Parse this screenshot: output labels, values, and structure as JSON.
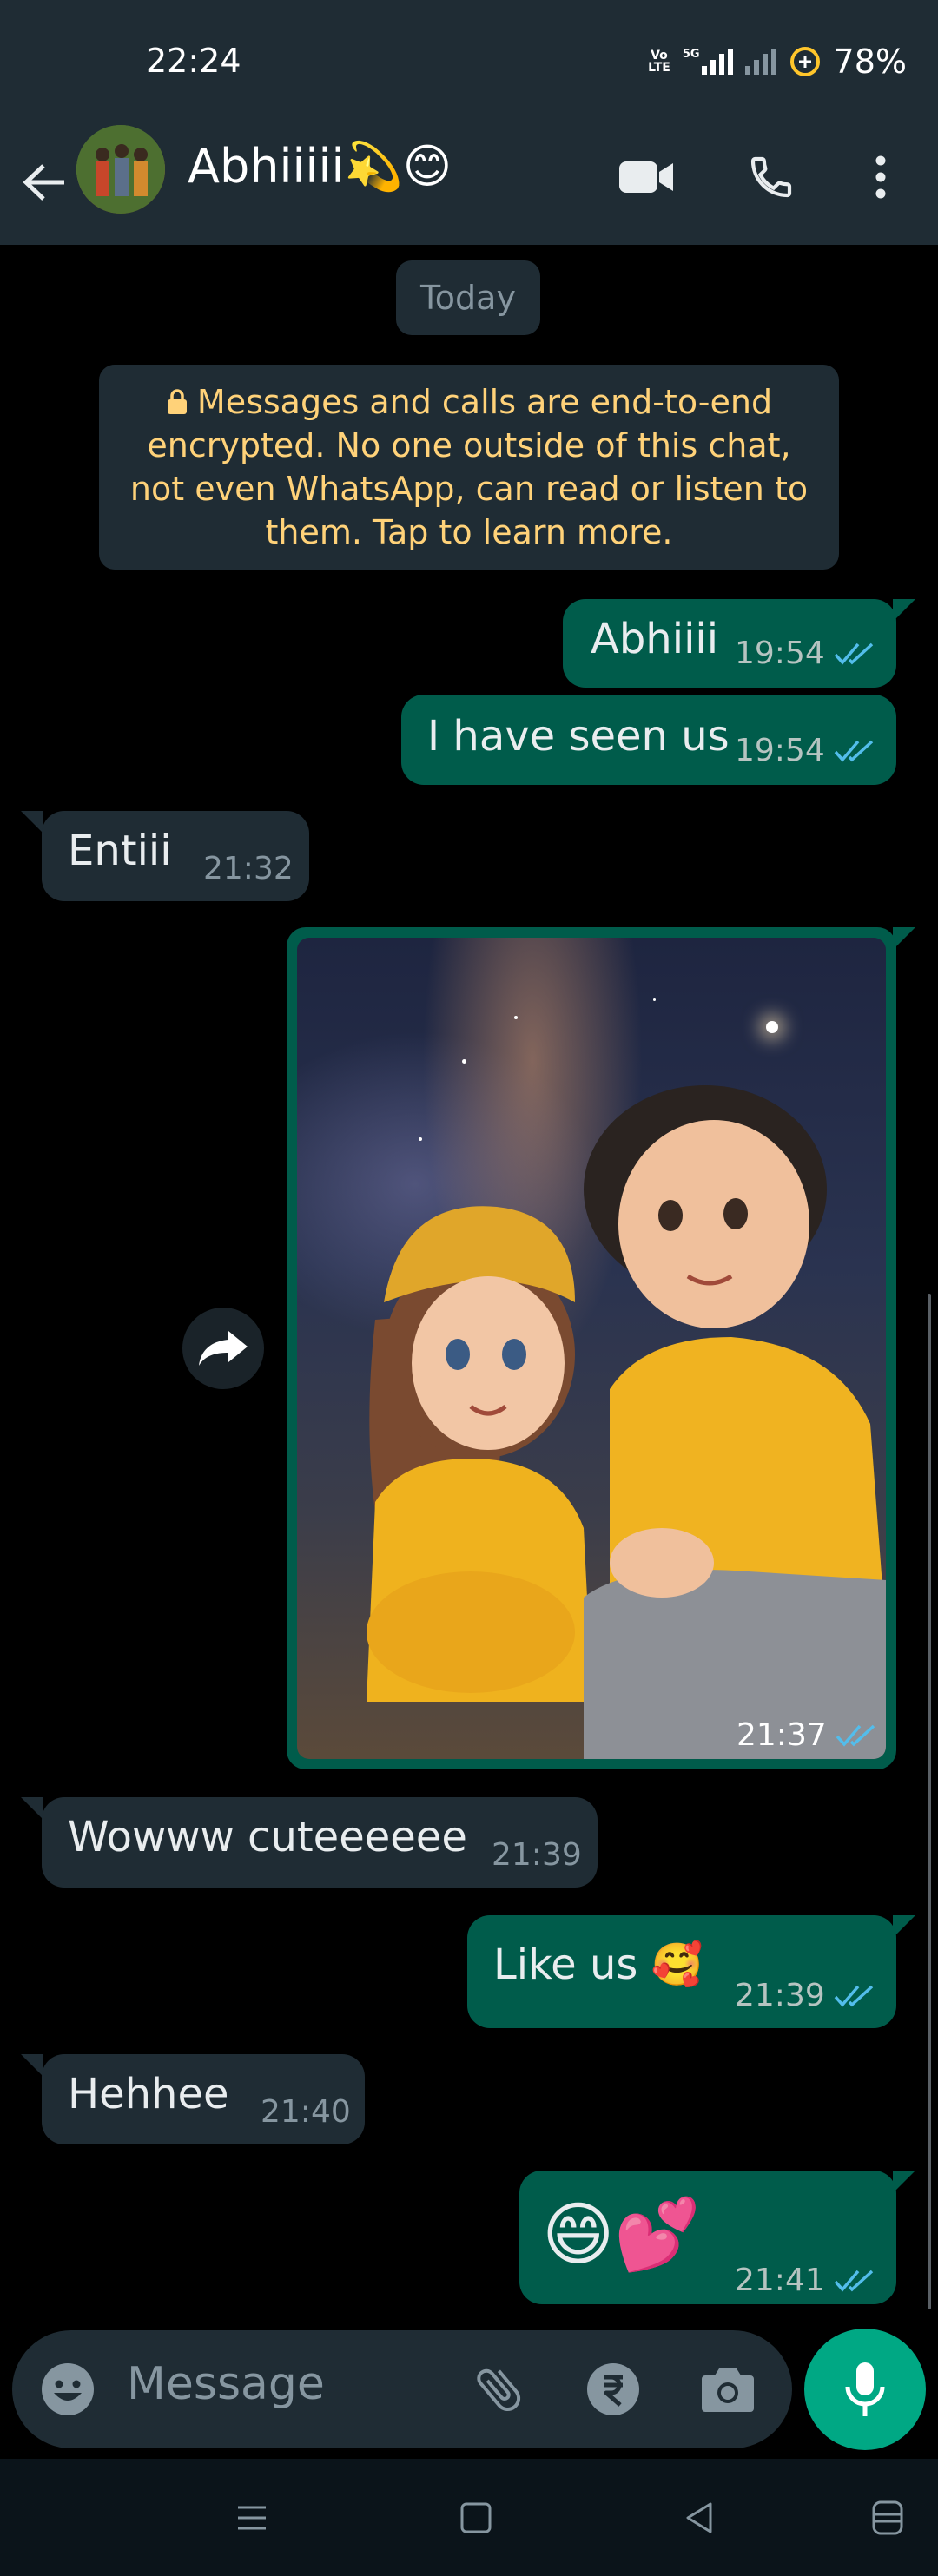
{
  "status_bar": {
    "time": "22:24",
    "volte_line1": "Vo",
    "volte_line2": "LTE",
    "network": "5G",
    "battery": "78%"
  },
  "header": {
    "contact_name": "Abhiiiii💫😊",
    "icons": [
      "back-arrow-icon",
      "video-call-icon",
      "phone-icon",
      "more-options-icon"
    ]
  },
  "date_chip": "Today",
  "encryption_notice": "Messages and calls are end-to-end encrypted. No one outside of this chat, not even WhatsApp, can read or listen to them. Tap to learn more.",
  "messages": [
    {
      "direction": "out",
      "text": "Abhiiii",
      "time": "19:54",
      "read": true
    },
    {
      "direction": "out",
      "text": "I have seen us",
      "time": "19:54",
      "read": true
    },
    {
      "direction": "in",
      "text": "Entiii",
      "time": "21:32"
    },
    {
      "direction": "out",
      "type": "image",
      "time": "21:37",
      "read": true
    },
    {
      "direction": "in",
      "text": "Wowww cuteeeeee",
      "time": "21:39"
    },
    {
      "direction": "out",
      "text": "Like us 🥰",
      "time": "21:39",
      "read": true
    },
    {
      "direction": "in",
      "text": "Hehhee",
      "time": "21:40"
    },
    {
      "direction": "out",
      "text": "😄💕",
      "time": "21:41",
      "read": true
    }
  ],
  "composer": {
    "placeholder": "Message"
  },
  "colors": {
    "outgoing_bubble": "#005c4b",
    "incoming_bubble": "#1f2c34",
    "read_ticks": "#53bdeb",
    "accent": "#00a884",
    "notice_text": "#ffd279"
  }
}
